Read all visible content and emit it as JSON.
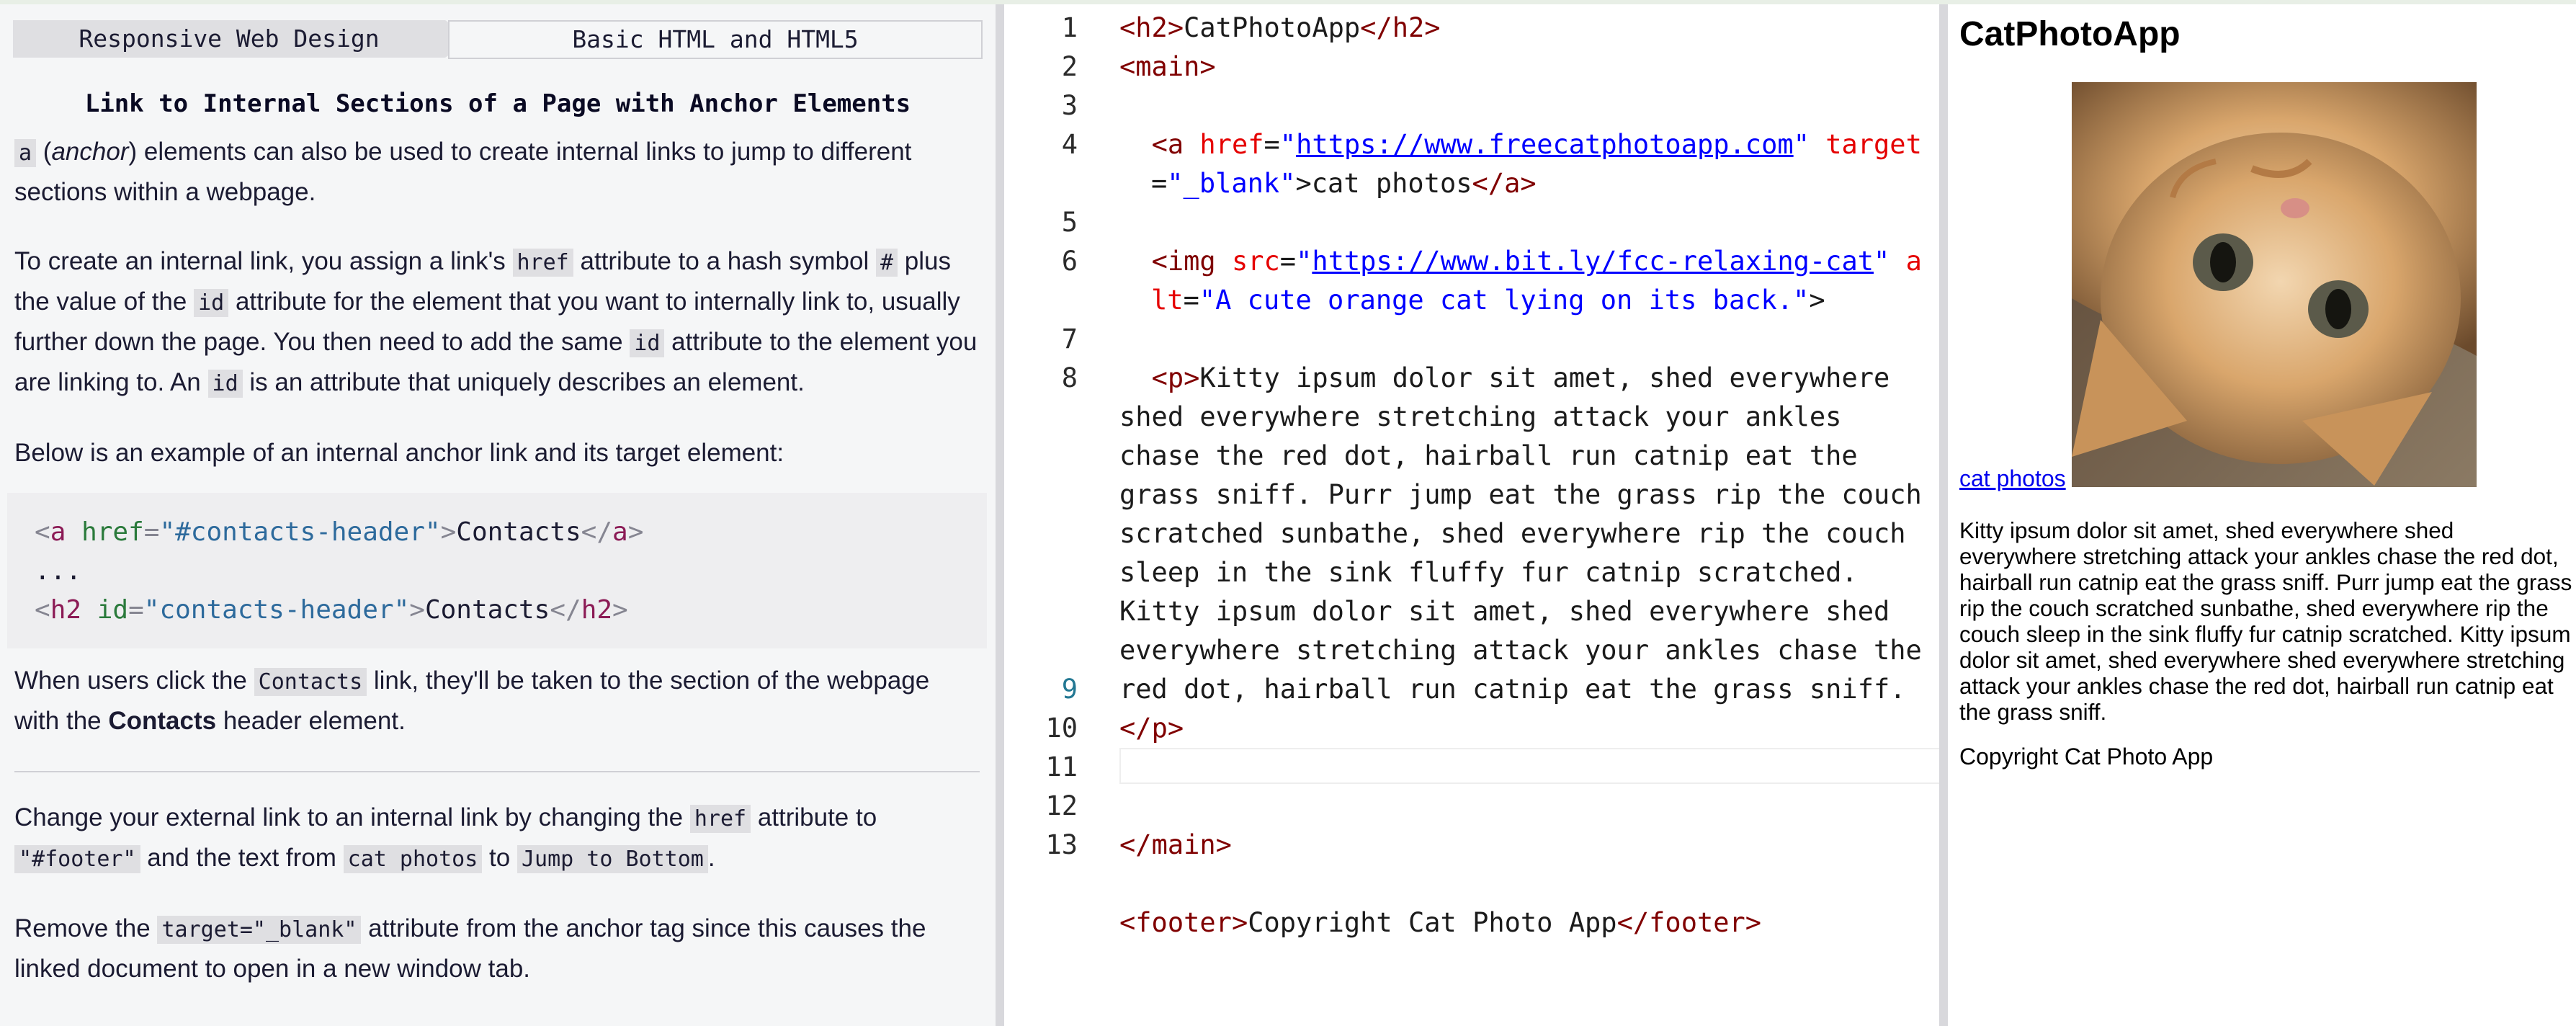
{
  "breadcrumb": {
    "superblock": "Responsive Web Design",
    "block": "Basic HTML and HTML5"
  },
  "challenge": {
    "title": "Link to Internal Sections of a Page with Anchor Elements",
    "p1": {
      "code_a": "a",
      "anchor_word": "anchor",
      "text": "elements can also be used to create internal links to jump to different sections within a webpage."
    },
    "p2": {
      "t1": "To create an internal link, you assign a link's",
      "code_href": "href",
      "t2": "attribute to a hash symbol",
      "code_hash": "#",
      "t3": "plus the value of the",
      "code_id": "id",
      "t4": "attribute for the element that you want to internally link to, usually further down the page. You then need to add the same",
      "code_id2": "id",
      "t5": "attribute to the element you are linking to. An",
      "code_id3": "id",
      "t6": "is an attribute that uniquely describes an element."
    },
    "p3": "Below is an example of an internal anchor link and its target element:",
    "example": {
      "l1": {
        "open": "<",
        "tag": "a",
        "attr": "href",
        "eq": "=",
        "val": "\"#contacts-header\"",
        "gt": ">",
        "text": "Contacts",
        "close_open": "</",
        "close_tag": "a",
        "close_gt": ">"
      },
      "l2": "...",
      "l3": {
        "open": "<",
        "tag": "h2",
        "attr": "id",
        "eq": "=",
        "val": "\"contacts-header\"",
        "gt": ">",
        "text": "Contacts",
        "close_open": "</",
        "close_tag": "h2",
        "close_gt": ">"
      }
    },
    "p4": {
      "t1": "When users click the",
      "code": "Contacts",
      "t2": "link, they'll be taken to the section of the webpage with the",
      "bold": "Contacts",
      "t3": "header element."
    },
    "instr1": {
      "t1": "Change your external link to an internal link by changing the",
      "code_href": "href",
      "t2": "attribute to",
      "code_footer": "\"#footer\"",
      "t3": "and the text from",
      "code_from": "cat photos",
      "t4": "to",
      "code_to": "Jump to Bottom",
      "t5": "."
    },
    "instr2": {
      "t1": "Remove the",
      "code": "target=\"_blank\"",
      "t2": "attribute from the anchor tag since this causes the linked document to open in a new window tab."
    }
  },
  "editor": {
    "line_numbers": [
      "1",
      "2",
      "3",
      "4",
      "5",
      "6",
      "7",
      "8",
      "9",
      "10",
      "11",
      "12",
      "13"
    ],
    "l1": {
      "lt": "<",
      "tag": "h2",
      "gt": ">",
      "text": "CatPhotoApp",
      "clt": "</",
      "ctag": "h2",
      "cgt": ">"
    },
    "l2": {
      "lt": "<",
      "tag": "main",
      "gt": ">"
    },
    "l4": {
      "lt": "<",
      "tag": "a",
      "attr1": "href",
      "eq1": "=",
      "q1o": "\"",
      "url": "https://www.freecatphotoapp.com",
      "q1c": "\"",
      "attr2": "target",
      "eq2": "=",
      "val2": "\"_blank\"",
      "gt": ">",
      "text": "cat photos",
      "clt": "</",
      "ctag": "a",
      "cgt": ">"
    },
    "l6": {
      "lt": "<",
      "tag": "img",
      "attr1": "src",
      "eq1": "=",
      "q1o": "\"",
      "url": "https://www.bit.ly/fcc-relaxing-cat",
      "q1c": "\"",
      "attr2": "alt",
      "eq2": "=",
      "val2": "\"A cute orange cat lying on its back.\"",
      "gt": ">"
    },
    "l8": {
      "lt": "<",
      "tag": "p",
      "gt": ">",
      "text": "Kitty ipsum dolor sit amet, shed everywhere shed everywhere stretching attack your ankles chase the red dot, hairball run catnip eat the grass sniff. Purr jump eat the grass rip the couch scratched sunbathe, shed everywhere rip the couch sleep in the sink fluffy fur catnip scratched. Kitty ipsum dolor sit amet, shed everywhere shed everywhere stretching attack your ankles chase the red dot, hairball run catnip eat the grass sniff.",
      "clt": "</",
      "ctag": "p",
      "cgt": ">"
    },
    "l11": {
      "clt": "</",
      "ctag": "main",
      "cgt": ">"
    },
    "l13": {
      "lt": "<",
      "tag": "footer",
      "gt": ">",
      "text": "Copyright Cat Photo App",
      "clt": "</",
      "ctag": "footer",
      "cgt": ">"
    }
  },
  "preview": {
    "heading": "CatPhotoApp",
    "link": "cat photos",
    "paragraph": "Kitty ipsum dolor sit amet, shed everywhere shed everywhere stretching attack your ankles chase the red dot, hairball run catnip eat the grass sniff. Purr jump eat the grass rip the couch scratched sunbathe, shed everywhere rip the couch sleep in the sink fluffy fur catnip scratched. Kitty ipsum dolor sit amet, shed everywhere shed everywhere stretching attack your ankles chase the red dot, hairball run catnip eat the grass sniff.",
    "footer": "Copyright Cat Photo App"
  }
}
